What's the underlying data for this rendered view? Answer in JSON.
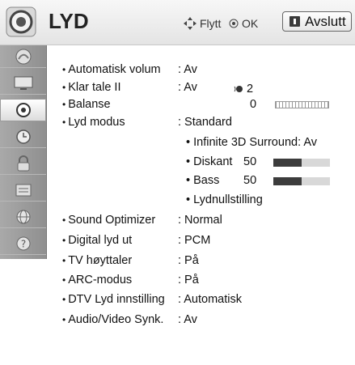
{
  "header": {
    "title": "LYD",
    "hint_move": "Flytt",
    "hint_ok": "OK",
    "exit_label": "Avslutt"
  },
  "sidebar": {
    "items": [
      {
        "name": "picture",
        "icon": "picture-icon"
      },
      {
        "name": "screen",
        "icon": "tv-screen-icon"
      },
      {
        "name": "audio",
        "icon": "speaker-icon",
        "active": true
      },
      {
        "name": "time",
        "icon": "clock-icon"
      },
      {
        "name": "lock",
        "icon": "lock-icon"
      },
      {
        "name": "options",
        "icon": "options-icon"
      },
      {
        "name": "network",
        "icon": "network-icon"
      },
      {
        "name": "support",
        "icon": "help-icon"
      }
    ]
  },
  "settings": [
    {
      "label": "Automatisk volum",
      "value": ": Av"
    },
    {
      "label": "Klar tale II",
      "value": ": Av",
      "level": "2"
    },
    {
      "label": "Balanse",
      "balance": "0"
    },
    {
      "label": "Lyd modus",
      "value": ": Standard"
    },
    {
      "label": "Sound Optimizer",
      "value": ": Normal"
    },
    {
      "label": "Digital lyd ut",
      "value": ": PCM"
    },
    {
      "label": "TV høyttaler",
      "value": ": På"
    },
    {
      "label": "ARC-modus",
      "value": ": På"
    },
    {
      "label": "DTV Lyd innstilling",
      "value": ": Automatisk"
    },
    {
      "label": "Audio/Video Synk.",
      "value": ": Av"
    }
  ],
  "sound_mode": {
    "surround": "• Infinite 3D Surround: Av",
    "treble_label": "• Diskant",
    "treble_value": "50",
    "treble_fraction": 0.5,
    "bass_label": "• Bass",
    "bass_value": "50",
    "bass_fraction": 0.5,
    "reset": "• Lydnullstilling"
  },
  "colors": {
    "sidebar": "#999999",
    "bar_fill": "#3c3c3c",
    "bar_track": "#d8d8d8"
  }
}
